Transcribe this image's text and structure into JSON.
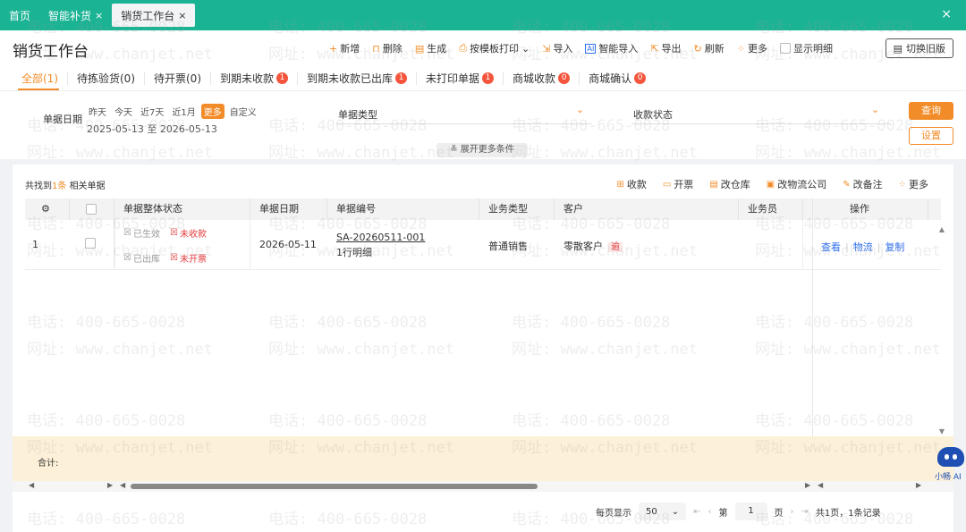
{
  "topbar": {
    "tabs": [
      {
        "label": "首页",
        "closable": false
      },
      {
        "label": "智能补货",
        "closable": true
      },
      {
        "label": "销货工作台",
        "closable": true,
        "active": true
      }
    ],
    "close_glyph": "×"
  },
  "header": {
    "title": "销货工作台",
    "toolbar": [
      {
        "icon": "plus-icon",
        "glyph": "+",
        "label": "新增"
      },
      {
        "icon": "trash-icon",
        "glyph": "🗑",
        "label": "删除"
      },
      {
        "icon": "generate-icon",
        "glyph": "▤",
        "label": "生成"
      },
      {
        "icon": "print-icon",
        "glyph": "⎙",
        "label": "按模板打印"
      },
      {
        "icon": "import-icon",
        "glyph": "⇲",
        "label": "导入"
      },
      {
        "icon": "ai-import-icon",
        "glyph": "AI",
        "label": "智能导入"
      },
      {
        "icon": "export-icon",
        "glyph": "⇱",
        "label": "导出"
      },
      {
        "icon": "refresh-icon",
        "glyph": "↻",
        "label": "刷新"
      },
      {
        "icon": "more-icon",
        "glyph": "⁘",
        "label": "更多"
      }
    ],
    "show_detail_label": "显示明细",
    "switch_label": "切换旧版"
  },
  "filter_tabs": [
    {
      "label": "全部(1)",
      "active": true
    },
    {
      "label": "待拣验货(0)"
    },
    {
      "label": "待开票(0)"
    },
    {
      "label": "到期未收款",
      "badge": "1"
    },
    {
      "label": "到期未收款已出库",
      "badge": "1"
    },
    {
      "label": "未打印单据",
      "badge": "1"
    },
    {
      "label": "商城收款",
      "badge": "0"
    },
    {
      "label": "商城确认",
      "badge": "0"
    }
  ],
  "filter": {
    "date_label": "单据日期",
    "quick_dates": [
      "昨天",
      "今天",
      "近7天",
      "近1月",
      "更多",
      "自定义"
    ],
    "active_quick": "更多",
    "date_range": "2025-05-13 至 2026-05-13",
    "doc_type_label": "单据类型",
    "pay_status_label": "收款状态",
    "query_label": "查询",
    "settings_label": "设置",
    "expand_label": "展开更多条件"
  },
  "results": {
    "found_prefix": "共找到",
    "found_count": "1",
    "found_suffix": "条",
    "found_tail": "相关单据",
    "actions": [
      {
        "icon": "receipt-icon",
        "label": "收款"
      },
      {
        "icon": "invoice-icon",
        "label": "开票"
      },
      {
        "icon": "warehouse-icon",
        "label": "改仓库"
      },
      {
        "icon": "truck-icon",
        "label": "改物流公司"
      },
      {
        "icon": "note-icon",
        "label": "改备注"
      },
      {
        "icon": "more-icon",
        "label": "更多"
      }
    ]
  },
  "table": {
    "columns": [
      "单据整体状态",
      "单据日期",
      "单据编号",
      "业务类型",
      "客户",
      "业务员",
      "操作"
    ],
    "rows": [
      {
        "index": "1",
        "status": [
          "已生效",
          "未收款",
          "已出库",
          "未开票"
        ],
        "date": "2026-05-11",
        "code": "SA-20260511-001",
        "detail": "1行明细",
        "biz_type": "普通销售",
        "customer": "零散客户",
        "customer_tag": "逾",
        "salesman": "",
        "ops": [
          "查看",
          "物流",
          "复制"
        ]
      }
    ],
    "total_label": "合计:"
  },
  "pager": {
    "per_page_label": "每页显示",
    "per_page": "50",
    "page_prefix": "第",
    "page": "1",
    "page_suffix": "页",
    "summary": "共1页，1条记录"
  },
  "assistant": {
    "label": "小畅 AI"
  },
  "watermark": {
    "phone": "电话: 400-665-0028",
    "site": "网址: www.chanjet.net"
  }
}
